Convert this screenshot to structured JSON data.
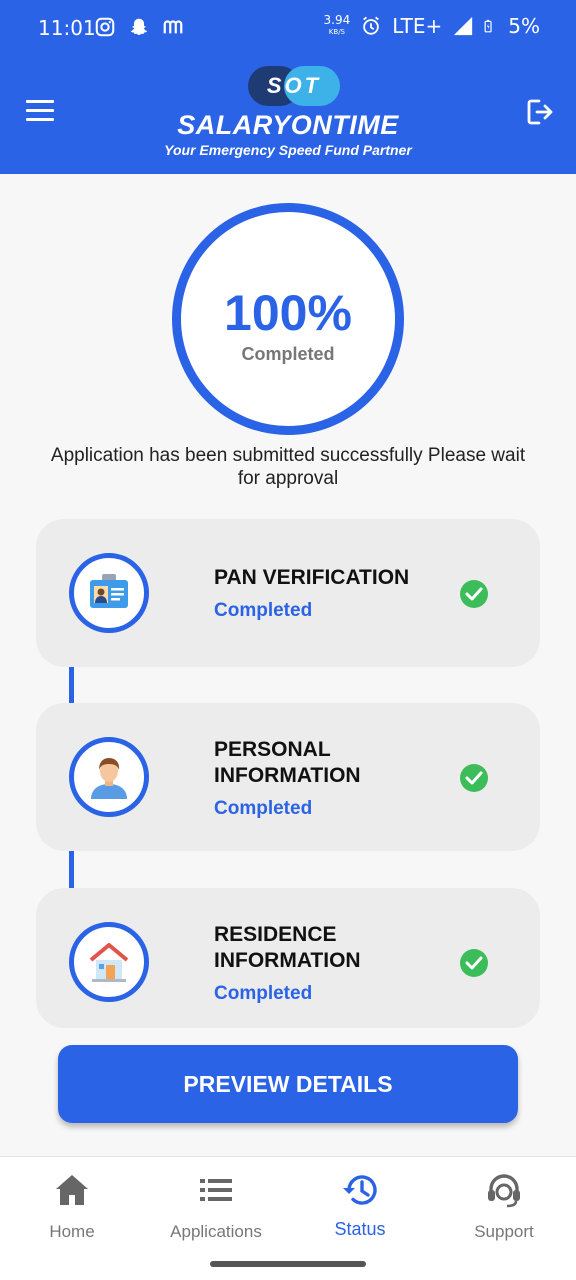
{
  "status_bar": {
    "time": "11:01",
    "net_speed": "3.94",
    "net_unit": "KB/S",
    "network": "LTE+",
    "battery": "5%"
  },
  "header": {
    "logo_badge": "SOT",
    "brand_name": "SALARYONTIME",
    "tagline": "Your Emergency Speed Fund Partner"
  },
  "progress": {
    "value": "100%",
    "label": "Completed"
  },
  "message": "Application has been submitted successfully Please wait for approval",
  "steps": [
    {
      "title": "PAN VERIFICATION",
      "status": "Completed"
    },
    {
      "title": "PERSONAL INFORMATION",
      "status": "Completed"
    },
    {
      "title": "RESIDENCE INFORMATION",
      "status": "Completed"
    }
  ],
  "preview_button": "PREVIEW DETAILS",
  "nav": [
    {
      "label": "Home",
      "icon": "home-icon"
    },
    {
      "label": "Applications",
      "icon": "list-icon"
    },
    {
      "label": "Status",
      "icon": "history-icon",
      "active": true
    },
    {
      "label": "Support",
      "icon": "headset-icon"
    }
  ],
  "colors": {
    "primary": "#2a63e6",
    "success": "#3dbc5a",
    "card_bg": "#ececec"
  }
}
